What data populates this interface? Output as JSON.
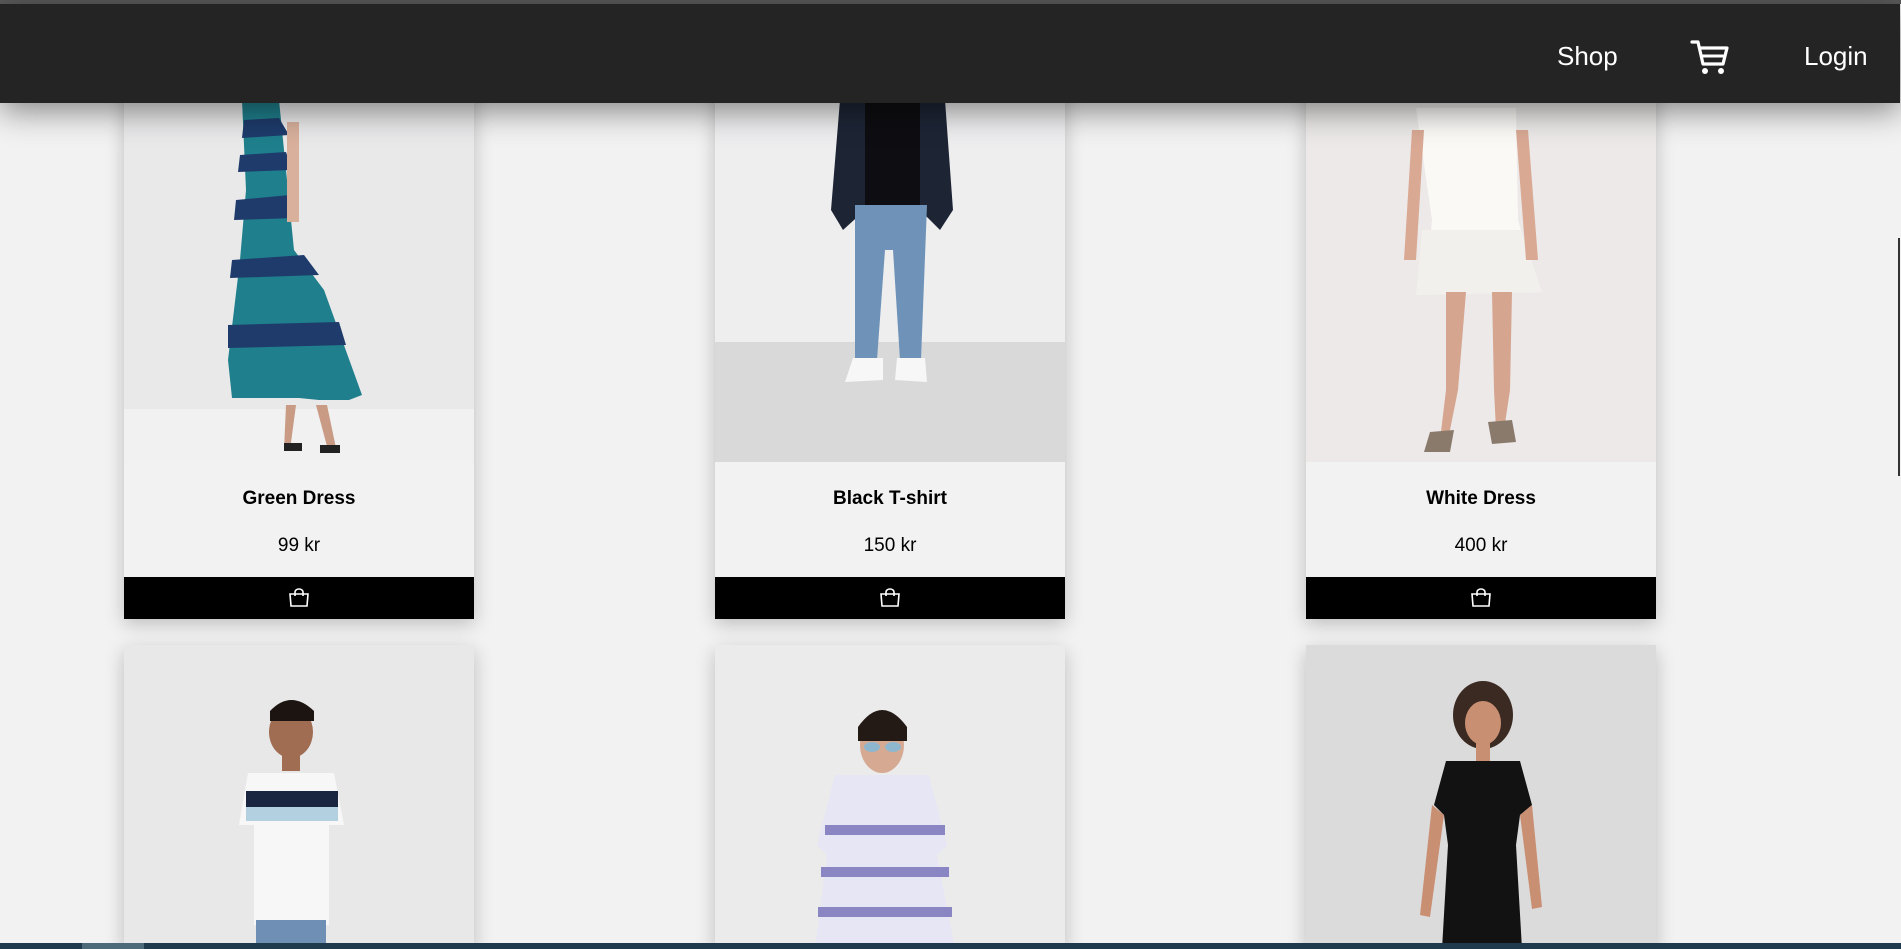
{
  "navbar": {
    "links": [
      {
        "label": "Shop"
      },
      {
        "label": "Login"
      }
    ],
    "cart_icon": "shopping-cart-icon"
  },
  "products": [
    {
      "name": "Green Dress",
      "price": "99 kr",
      "icon": "shopping-bag-icon"
    },
    {
      "name": "Black T-shirt",
      "price": "150 kr",
      "icon": "shopping-bag-icon"
    },
    {
      "name": "White Dress",
      "price": "400 kr",
      "icon": "shopping-bag-icon"
    },
    {
      "name": "",
      "price": ""
    },
    {
      "name": "",
      "price": ""
    },
    {
      "name": "",
      "price": ""
    }
  ]
}
